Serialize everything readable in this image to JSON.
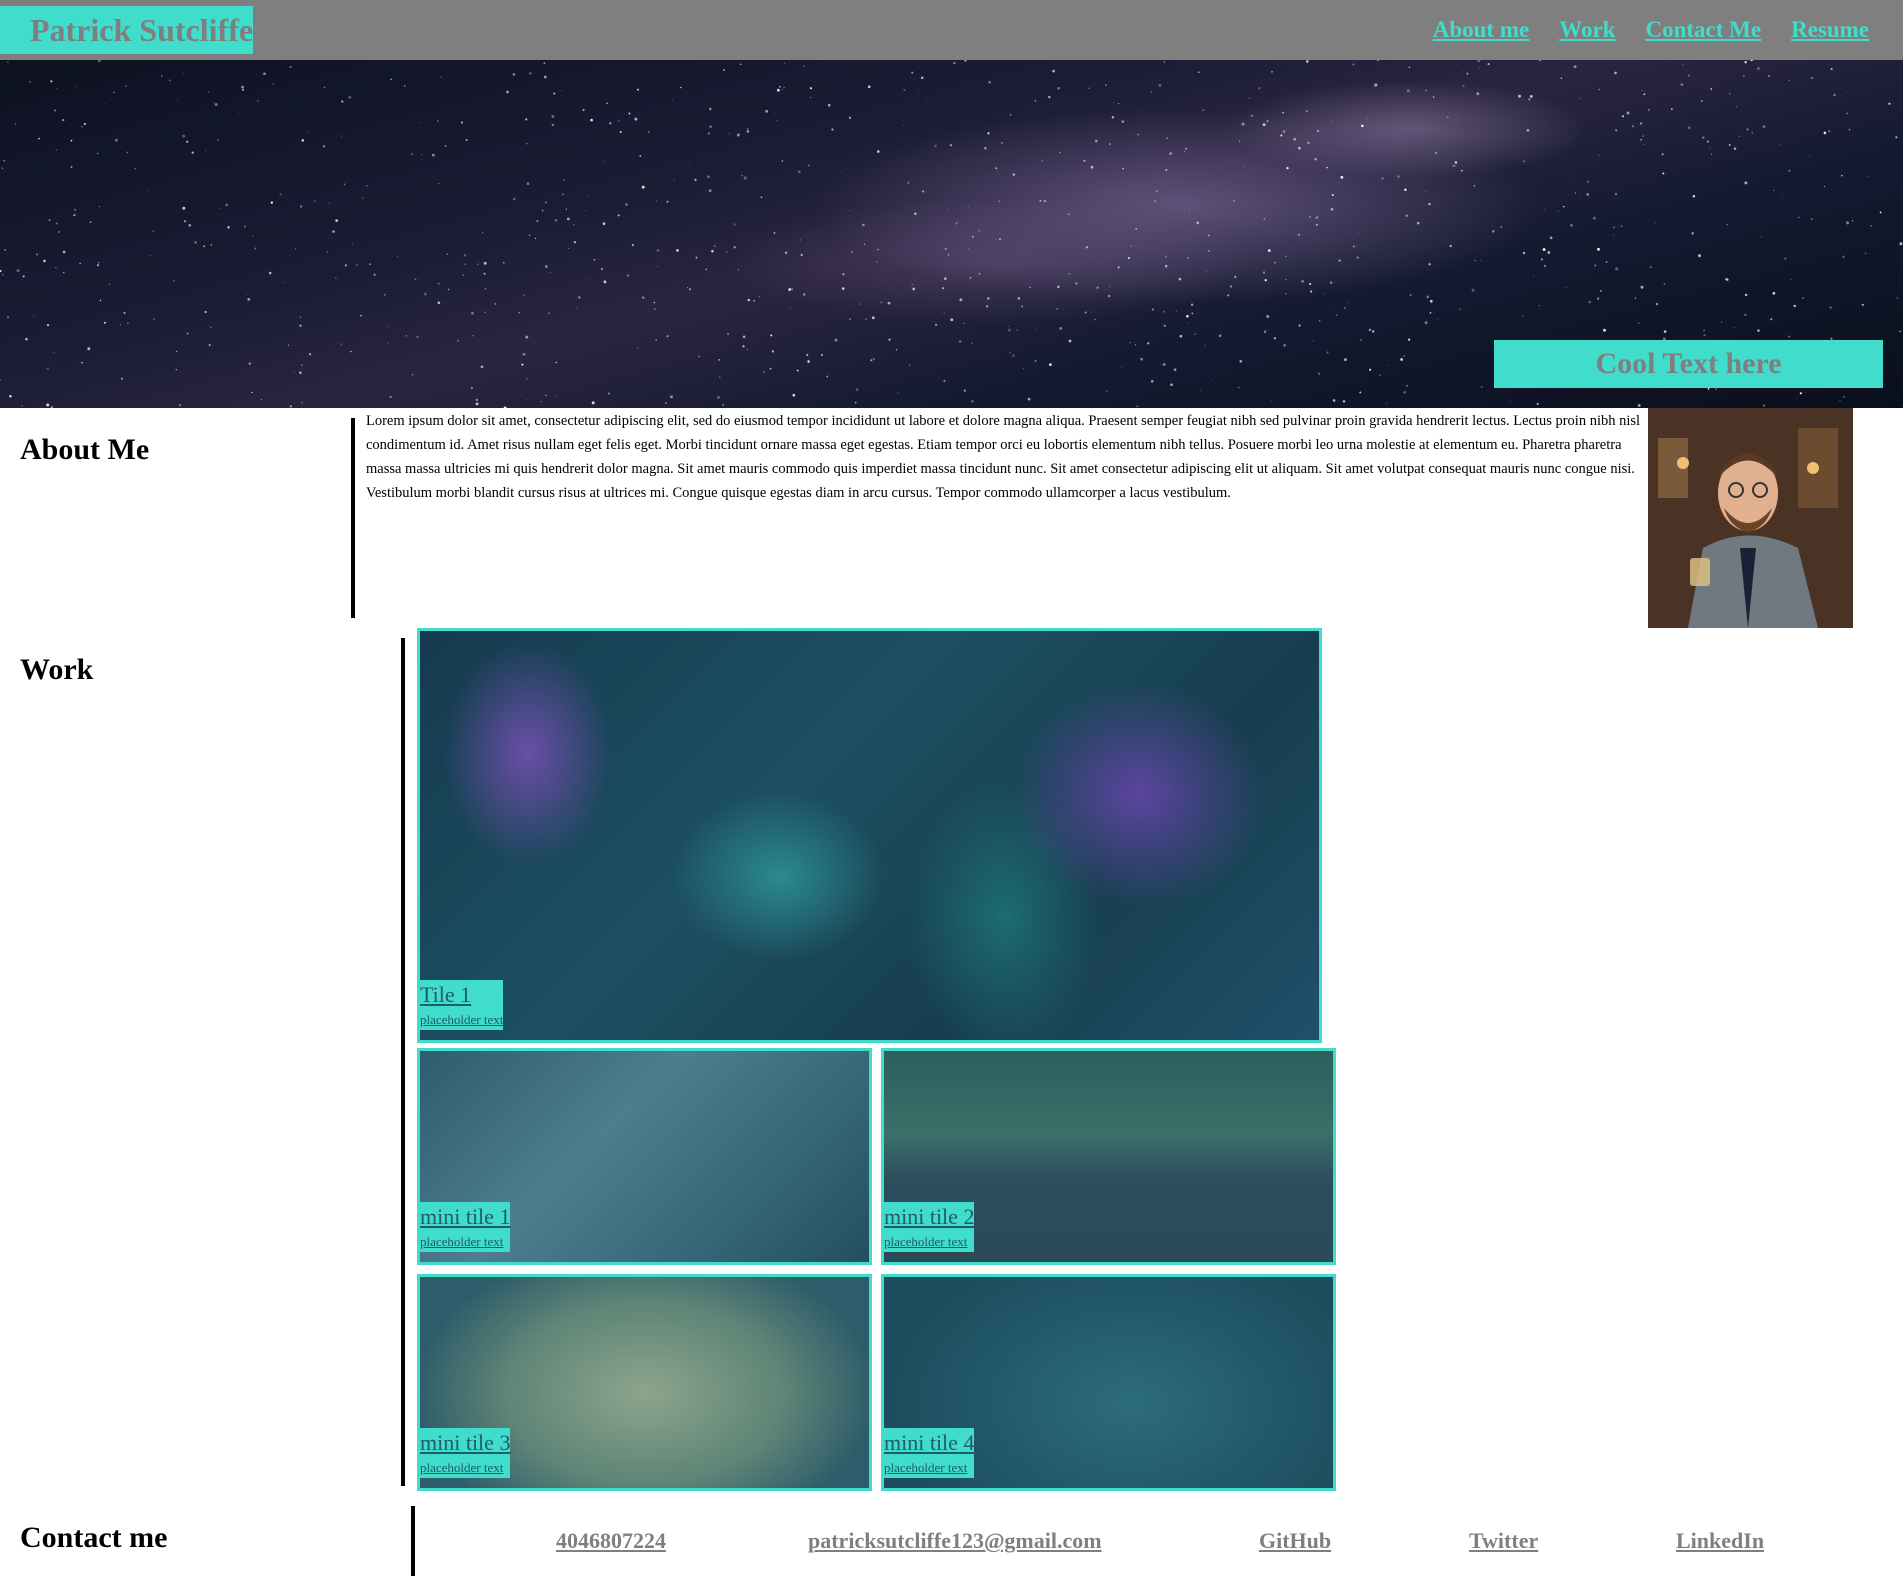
{
  "header": {
    "brand": "Patrick Sutcliffe",
    "nav": [
      "About me",
      "Work",
      "Contact Me",
      "Resume"
    ]
  },
  "hero": {
    "banner_text": "Cool Text here"
  },
  "about": {
    "title": "About Me",
    "body": "Lorem ipsum dolor sit amet, consectetur adipiscing elit, sed do eiusmod tempor incididunt ut labore et dolore magna aliqua. Praesent semper feugiat nibh sed pulvinar proin gravida hendrerit lectus. Lectus proin nibh nisl condimentum id. Amet risus nullam eget felis eget. Morbi tincidunt ornare massa eget egestas. Etiam tempor orci eu lobortis elementum nibh tellus. Posuere morbi leo urna molestie at elementum eu. Pharetra pharetra massa massa ultricies mi quis hendrerit dolor magna. Sit amet mauris commodo quis imperdiet massa tincidunt nunc. Sit amet consectetur adipiscing elit ut aliquam. Sit amet volutpat consequat mauris nunc congue nisi. Vestibulum morbi blandit cursus risus at ultrices mi. Congue quisque egestas diam in arcu cursus. Tempor commodo ullamcorper a lacus vestibulum."
  },
  "work": {
    "title": "Work",
    "tiles": [
      {
        "title": "Tile 1",
        "subtitle": "placeholder text"
      },
      {
        "title": "mini tile 1",
        "subtitle": "placeholder text"
      },
      {
        "title": "mini tile 2",
        "subtitle": "placeholder text"
      },
      {
        "title": "mini tile 3",
        "subtitle": "placeholder text"
      },
      {
        "title": "mini tile 4",
        "subtitle": "placeholder text"
      }
    ]
  },
  "contact": {
    "title": "Contact me",
    "links": [
      "4046807224",
      "patricksutcliffe123@gmail.com",
      "GitHub",
      "Twitter",
      "LinkedIn"
    ]
  },
  "colors": {
    "accent": "#40dccc",
    "header_bg": "#7f7f7f",
    "link_gray": "#7f7f7f"
  }
}
